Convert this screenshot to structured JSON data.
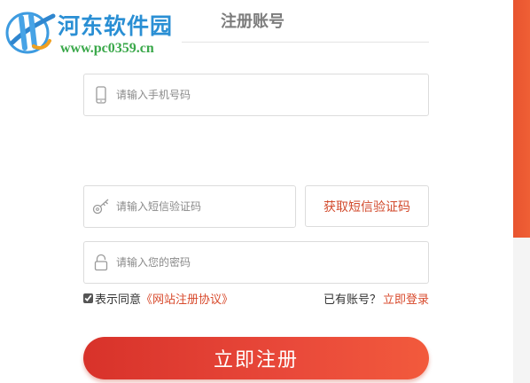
{
  "watermark": {
    "site_name": "河东软件园",
    "url": "www.pc0359.cn"
  },
  "page": {
    "title": "注册账号"
  },
  "form": {
    "phone": {
      "placeholder": "请输入手机号码",
      "value": "",
      "icon": "phone-icon"
    },
    "sms_code": {
      "placeholder": "请输入短信验证码",
      "value": "",
      "icon": "key-icon"
    },
    "get_sms_button": "获取短信验证码",
    "password": {
      "placeholder": "请输入您的密码",
      "value": "",
      "icon": "lock-icon"
    },
    "agree": {
      "checked": true,
      "label": "表示同意",
      "link_text": "《网站注册协议》"
    },
    "has_account_text": "已有账号？",
    "login_link": "立即登录",
    "submit_button": "立即注册"
  },
  "colors": {
    "accent": "#d84a2c",
    "button_gradient_start": "#d8322a",
    "button_gradient_end": "#f25a3c",
    "watermark_title": "#2a8fd4",
    "watermark_url": "#3aa84a"
  }
}
